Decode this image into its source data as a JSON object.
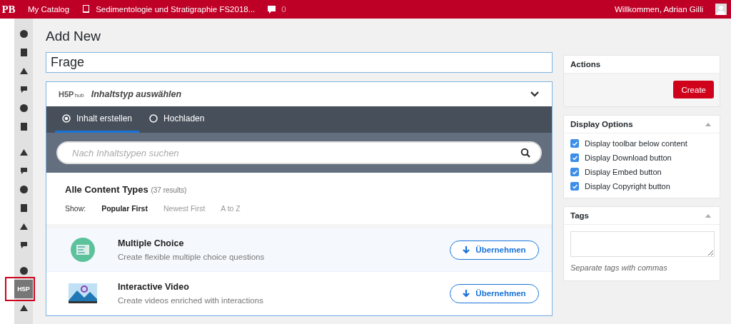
{
  "topbar": {
    "logo": "PB",
    "catalog": "My Catalog",
    "book": "Sedimentologie und Stratigraphie FS2018...",
    "comments": "0",
    "greeting": "Willkommen, Adrian Gilli"
  },
  "sidebar": {
    "items": [
      {
        "selected": false
      },
      {
        "selected": false
      },
      {
        "selected": false
      },
      {
        "selected": false
      },
      {
        "selected": false
      },
      {
        "selected": false
      },
      {
        "selected": false
      },
      {
        "selected": false
      },
      {
        "selected": false
      },
      {
        "selected": false
      },
      {
        "selected": false
      },
      {
        "selected": false
      },
      {
        "selected": false
      },
      {
        "selected": true,
        "label": "H5P"
      },
      {
        "selected": false
      }
    ]
  },
  "page_title": "Add New",
  "title_field": {
    "value": "Frage"
  },
  "hub": {
    "logo": "H5P",
    "logo_sub": "hub",
    "title": "Inhaltstyp auswählen",
    "expanded": true,
    "tabs": [
      {
        "label": "Inhalt erstellen",
        "selected": true
      },
      {
        "label": "Hochladen",
        "selected": false
      }
    ],
    "search": {
      "placeholder": "Nach Inhaltstypen suchen"
    },
    "heading": "Alle Content Types",
    "count": "(37 results)",
    "show_label": "Show:",
    "sort_options": [
      {
        "label": "Popular First",
        "selected": true
      },
      {
        "label": "Newest First",
        "selected": false
      },
      {
        "label": "A to Z",
        "selected": false
      }
    ],
    "content_types": [
      {
        "name": "Multiple Choice",
        "description": "Create flexible multiple choice questions",
        "button": "Übernehmen",
        "kind": "choice"
      },
      {
        "name": "Interactive Video",
        "description": "Create videos enriched with interactions",
        "button": "Übernehmen",
        "kind": "video"
      }
    ]
  },
  "actions": {
    "title": "Actions",
    "button": "Create"
  },
  "display_options": {
    "title": "Display Options",
    "options": [
      {
        "label": "Display toolbar below content",
        "checked": true
      },
      {
        "label": "Display Download button",
        "checked": true
      },
      {
        "label": "Display Embed button",
        "checked": true
      },
      {
        "label": "Display Copyright button",
        "checked": true
      }
    ]
  },
  "tags": {
    "title": "Tags",
    "hint": "Separate tags with commas"
  }
}
